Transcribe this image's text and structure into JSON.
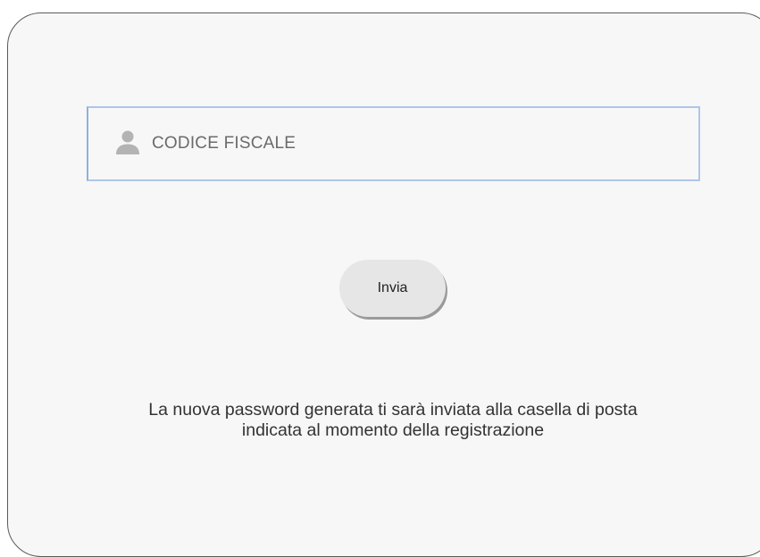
{
  "form": {
    "fiscal_code_placeholder": "CODICE FISCALE",
    "fiscal_code_value": "",
    "submit_label": "Invia"
  },
  "info": {
    "line1": "La nuova password generata ti sarà inviata alla casella di posta",
    "line2": "indicata al momento della registrazione"
  },
  "icons": {
    "field_icon": "user-icon"
  },
  "colors": {
    "field_border": "#aec6e8",
    "button_bg": "#e6e6e6",
    "panel_bg": "#f7f7f7"
  }
}
